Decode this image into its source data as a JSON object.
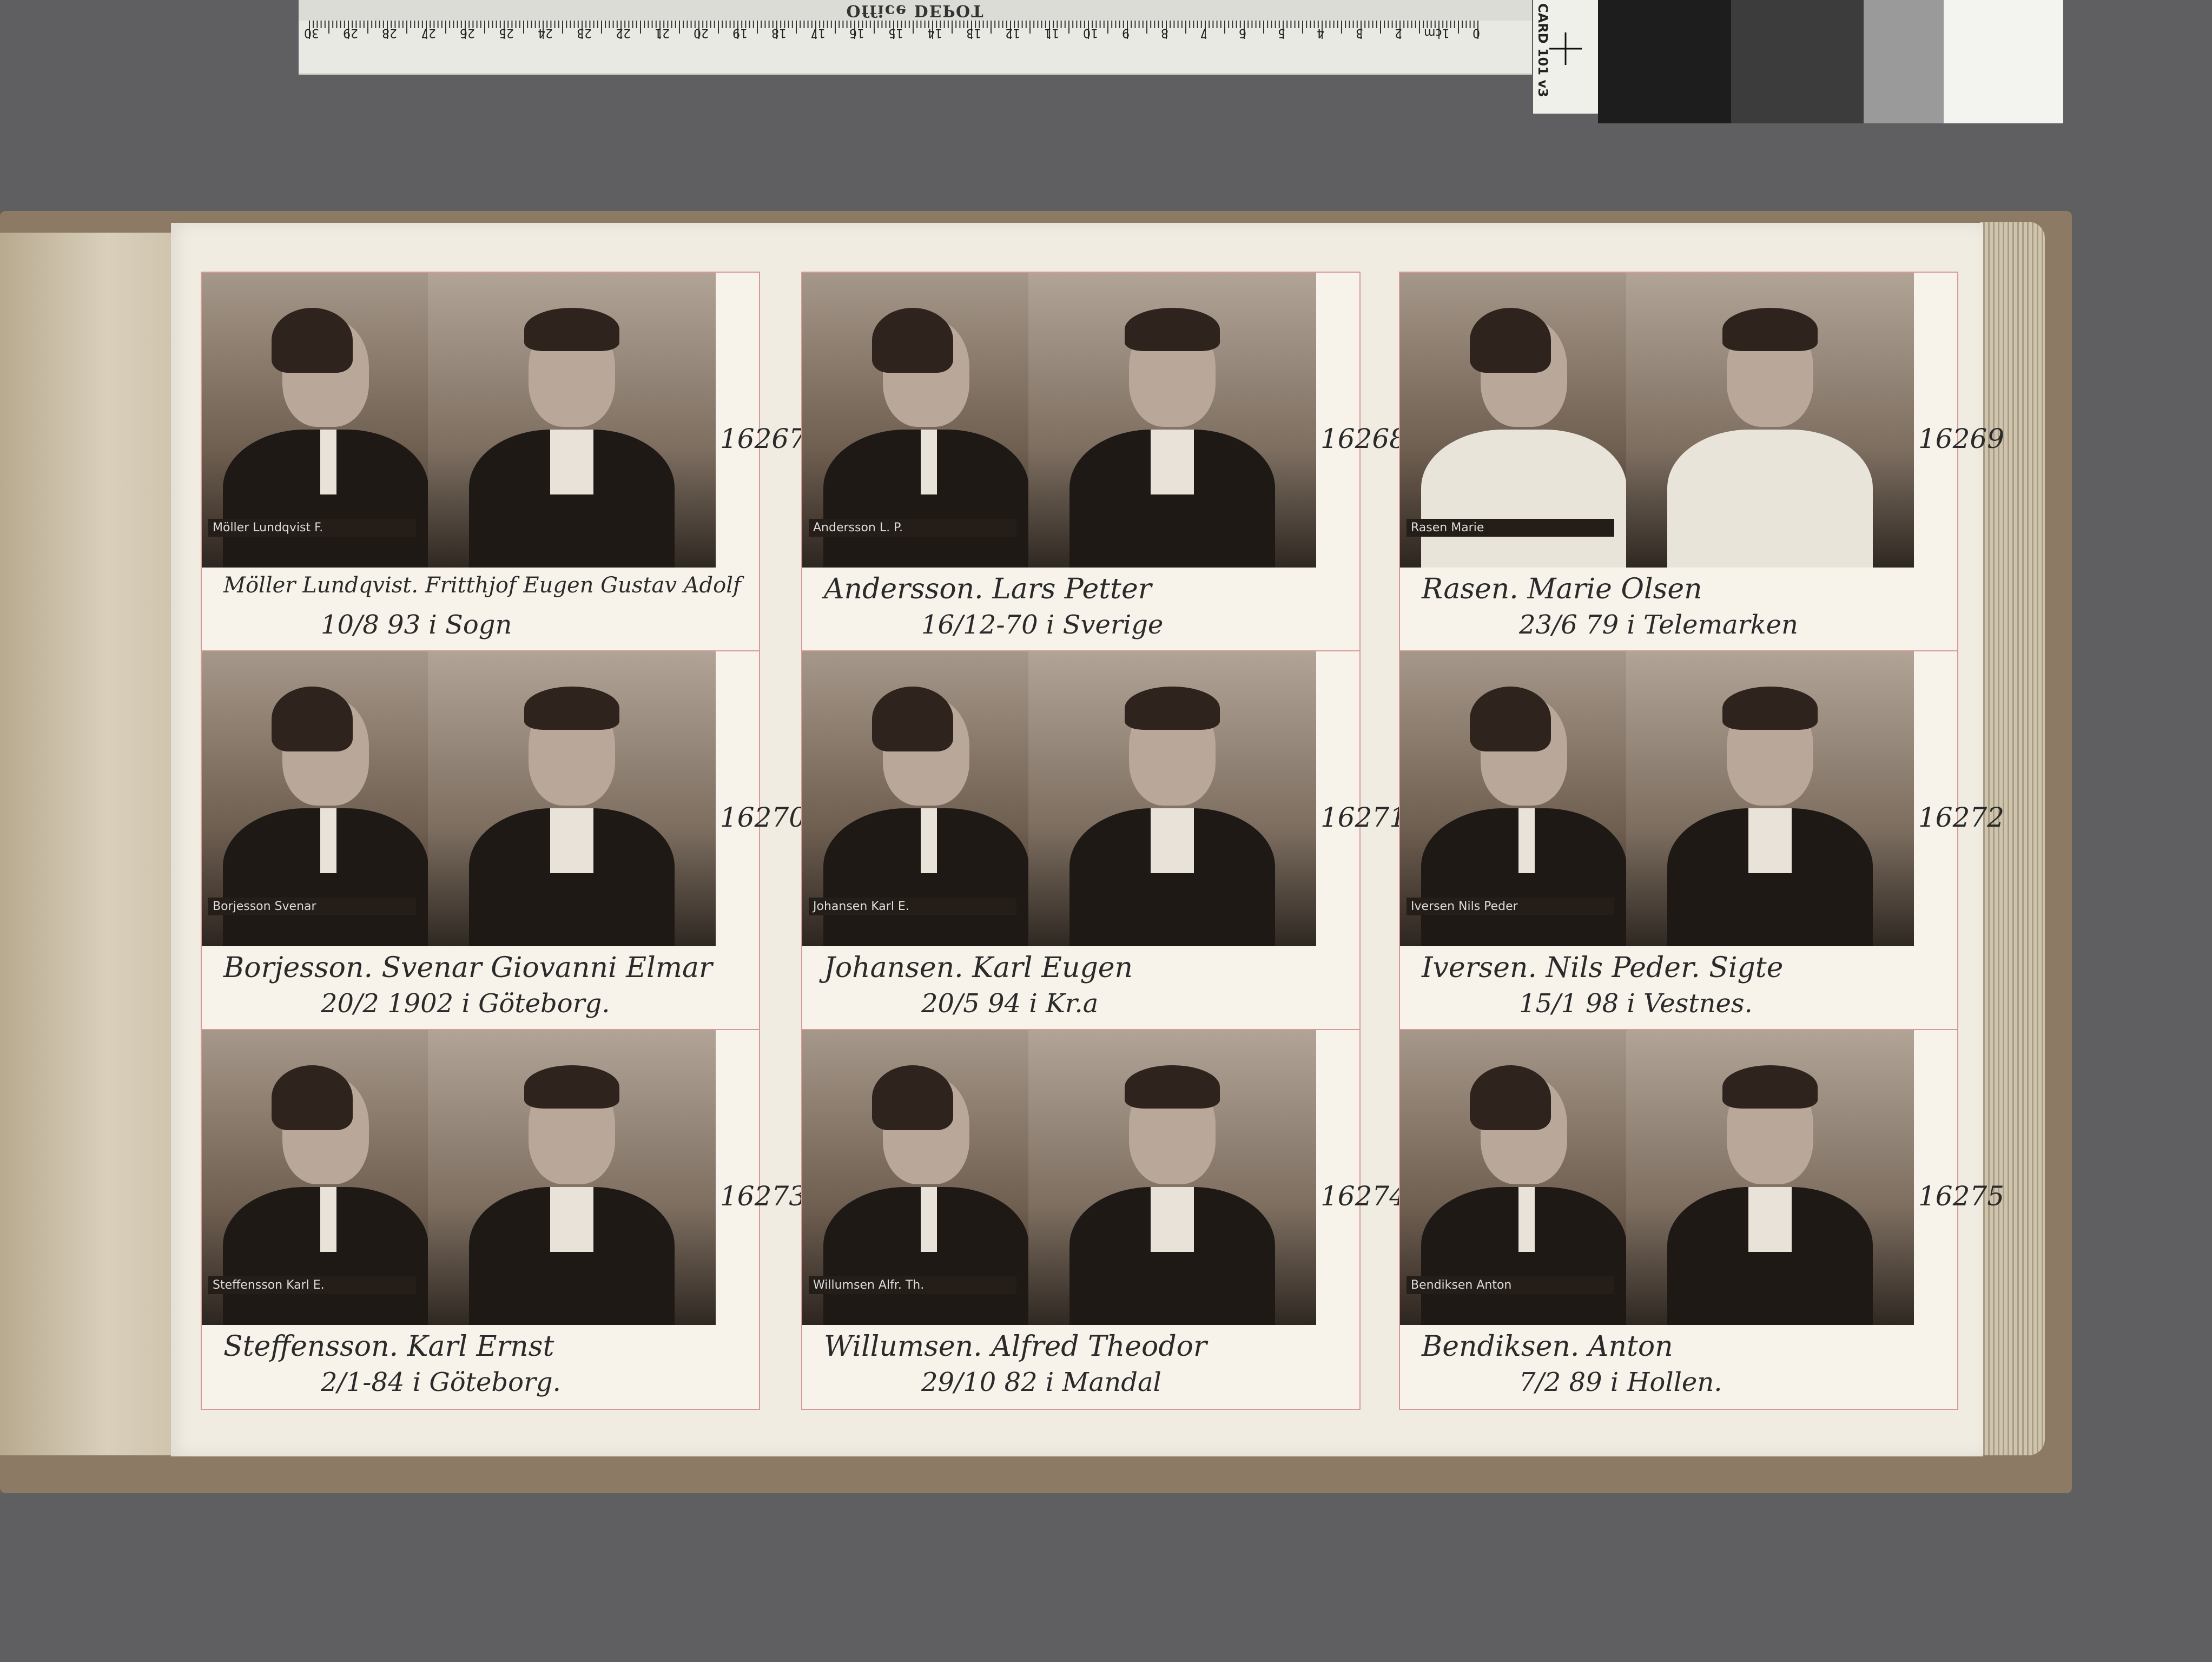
{
  "ruler": {
    "brand": "Office DEPOT",
    "unit_label": "1cm",
    "numbers": [
      "30",
      "29",
      "28",
      "27",
      "26",
      "25",
      "24",
      "23",
      "22",
      "21",
      "20",
      "19",
      "18",
      "17",
      "16",
      "15",
      "14",
      "13",
      "12",
      "11",
      "10",
      "9",
      "8",
      "7",
      "6",
      "5",
      "4",
      "3",
      "2",
      "0"
    ]
  },
  "color_card": {
    "label": "CARD 101 v3",
    "greys": [
      "#1d1d1d",
      "#3c3c3c",
      "#9a9a9a",
      "#f3f3f0"
    ]
  },
  "records": [
    {
      "number": "16267",
      "name": "Möller Lundqvist. Fritthjof Eugen Gustav Adolf",
      "birth": "10/8 93 i Sogn",
      "plate": "Möller Lundqvist F."
    },
    {
      "number": "16268",
      "name": "Andersson. Lars Petter",
      "birth": "16/12-70 i Sverige",
      "plate": "Andersson L. P."
    },
    {
      "number": "16269",
      "name": "Rasen. Marie Olsen",
      "birth": "23/6 79 i Telemarken",
      "plate": "Rasen Marie"
    },
    {
      "number": "16270",
      "name": "Borjesson. Svenar Giovanni Elmar",
      "birth": "20/2 1902 i Göteborg.",
      "plate": "Borjesson Svenar"
    },
    {
      "number": "16271",
      "name": "Johansen. Karl Eugen",
      "birth": "20/5 94 i Kr.a",
      "plate": "Johansen Karl E."
    },
    {
      "number": "16272",
      "name": "Iversen. Nils Peder. Sigte",
      "birth": "15/1 98 i Vestnes.",
      "plate": "Iversen Nils Peder"
    },
    {
      "number": "16273",
      "name": "Steffensson. Karl Ernst",
      "birth": "2/1-84 i Göteborg.",
      "plate": "Steffensson Karl E."
    },
    {
      "number": "16274",
      "name": "Willumsen. Alfred Theodor",
      "birth": "29/10 82 i Mandal",
      "plate": "Willumsen Alfr. Th."
    },
    {
      "number": "16275",
      "name": "Bendiksen. Anton",
      "birth": "7/2 89 i Hollen.",
      "plate": "Bendiksen Anton"
    }
  ]
}
